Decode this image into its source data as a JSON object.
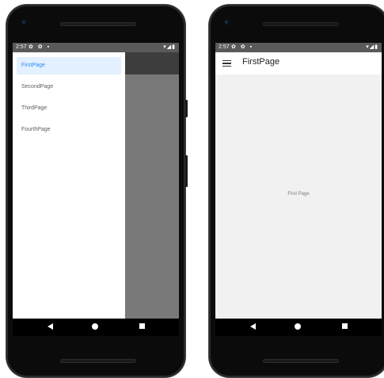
{
  "statusbar": {
    "time": "2:57",
    "left_icons": "✿ ✿ ▪",
    "right_icons": "▾◢▮"
  },
  "left_phone": {
    "drawer": {
      "items": [
        {
          "label": "FirstPage",
          "active": true
        },
        {
          "label": "SecondPage",
          "active": false
        },
        {
          "label": "ThirdPage",
          "active": false
        },
        {
          "label": "FourthPage",
          "active": false
        }
      ],
      "active_color": "#2b8cf0",
      "active_bg": "#e3f0ff"
    }
  },
  "right_phone": {
    "toolbar": {
      "title": "FirstPage",
      "menu_icon": "hamburger-icon"
    },
    "content": {
      "text": "First Page"
    }
  },
  "navigation": {
    "icons": [
      "back-icon",
      "home-icon",
      "recents-icon"
    ]
  }
}
